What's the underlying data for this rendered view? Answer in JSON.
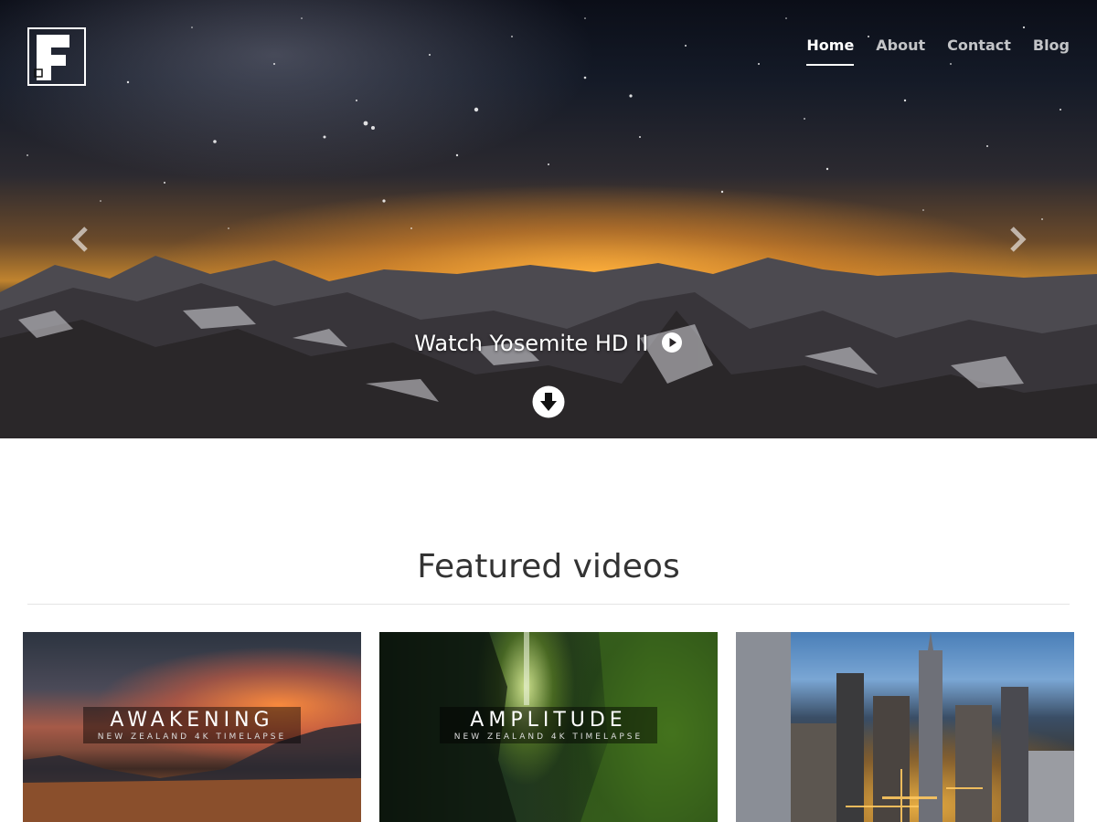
{
  "brand": {
    "logo_icon": "f-logo-icon",
    "logo_letter": "F"
  },
  "nav": {
    "items": [
      {
        "label": "Home",
        "active": true
      },
      {
        "label": "About",
        "active": false
      },
      {
        "label": "Contact",
        "active": false
      },
      {
        "label": "Blog",
        "active": false
      }
    ]
  },
  "hero": {
    "cta_label": "Watch Yosemite HD II",
    "cta_icon": "play-circle-icon",
    "prev_icon": "chevron-left-icon",
    "next_icon": "chevron-right-icon",
    "scroll_icon": "arrow-down-circle-icon"
  },
  "featured": {
    "title": "Featured videos",
    "videos": [
      {
        "title": "AWAKENING",
        "subtitle": "NEW ZEALAND 4K TIMELAPSE"
      },
      {
        "title": "AMPLITUDE",
        "subtitle": "NEW ZEALAND 4K TIMELAPSE"
      },
      {
        "title": "",
        "subtitle": ""
      }
    ]
  },
  "colors": {
    "accent": "#ffffff",
    "heading": "#333333",
    "divider": "#e5e5e5"
  }
}
